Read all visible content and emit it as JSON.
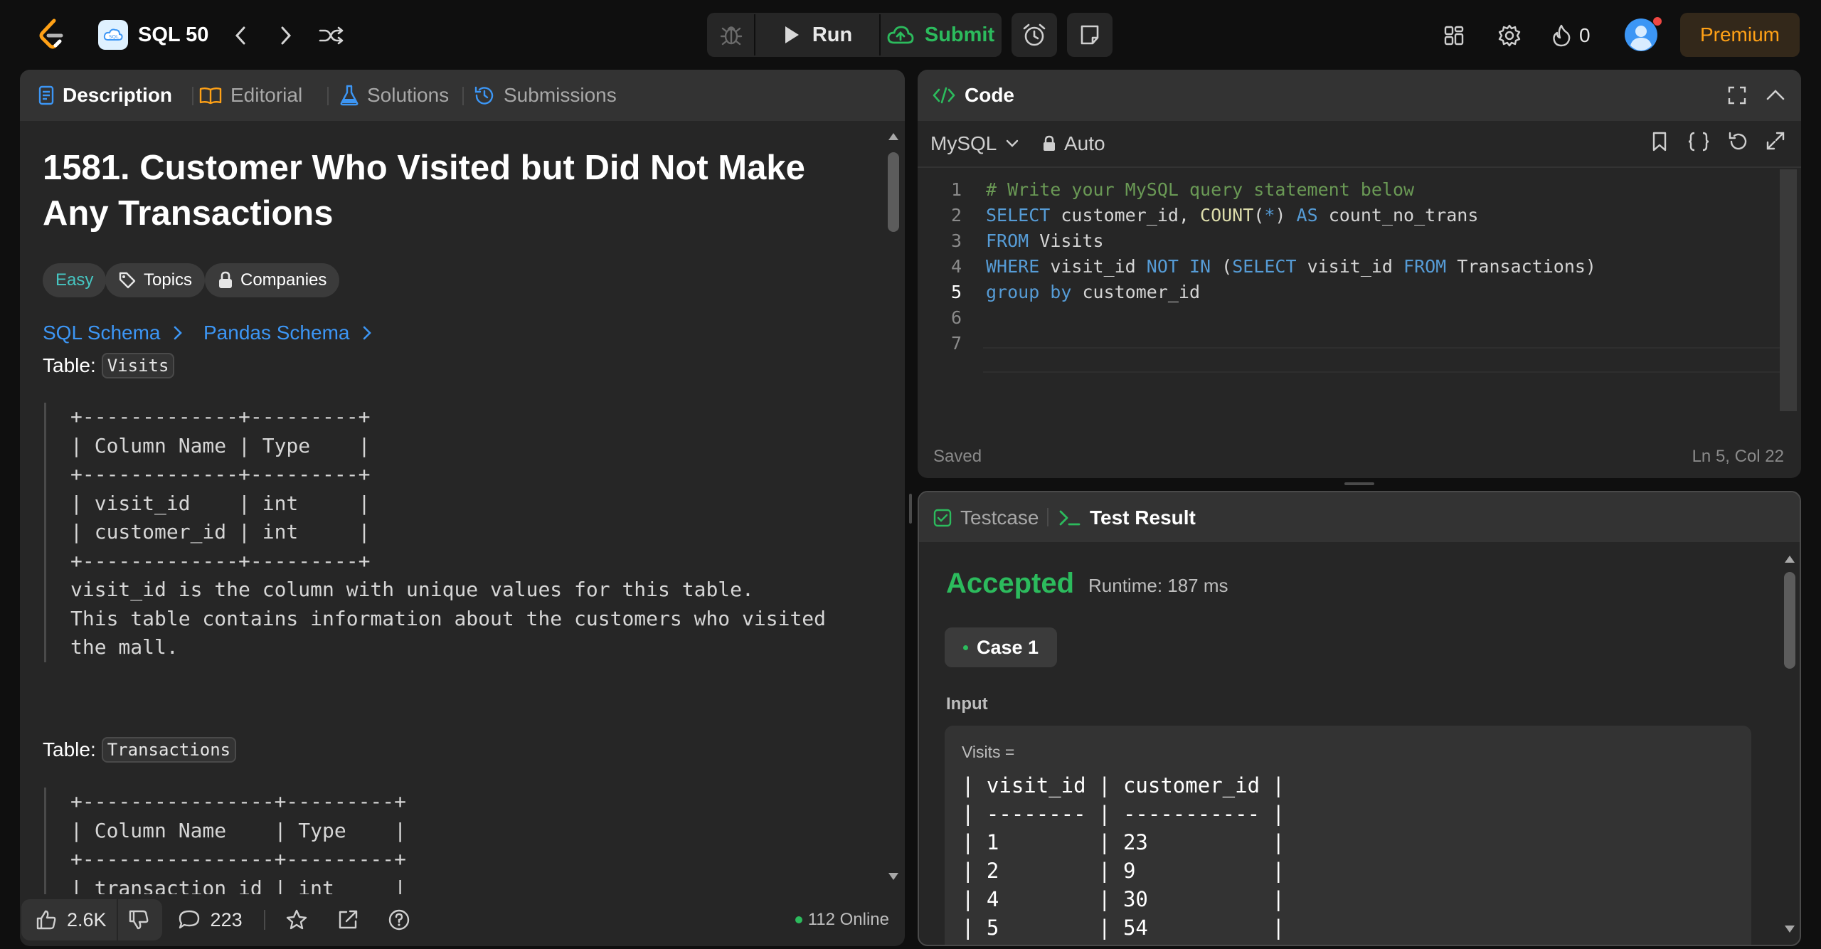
{
  "header": {
    "title": "SQL 50",
    "run_label": "Run",
    "submit_label": "Submit",
    "streak_count": "0",
    "premium_label": "Premium"
  },
  "description": {
    "tabs": [
      {
        "label": "Description"
      },
      {
        "label": "Editorial"
      },
      {
        "label": "Solutions"
      },
      {
        "label": "Submissions"
      }
    ],
    "title": "1581. Customer Who Visited but Did Not Make Any Transactions",
    "difficulty": "Easy",
    "topics_label": "Topics",
    "companies_label": "Companies",
    "sql_schema": "SQL Schema",
    "pandas_schema": "Pandas Schema",
    "table1_prefix": "Table:",
    "table1_name": "Visits",
    "table1_text": "+-------------+---------+\n| Column Name | Type    |\n+-------------+---------+\n| visit_id    | int     |\n| customer_id | int     |\n+-------------+---------+\nvisit_id is the column with unique values for this table.\nThis table contains information about the customers who visited\nthe mall.",
    "table2_prefix": "Table:",
    "table2_name": "Transactions",
    "table2_text": "+----------------+---------+\n| Column Name    | Type    |\n+----------------+---------+\n| transaction_id | int     |",
    "likes": "2.6K",
    "comments": "223",
    "online": "112 Online"
  },
  "code": {
    "title": "Code",
    "language": "MySQL",
    "mode": "Auto",
    "lines": [
      "1",
      "2",
      "3",
      "4",
      "5",
      "6",
      "7"
    ],
    "status": "Saved",
    "cursor": "Ln 5, Col 22"
  },
  "result": {
    "tabs": [
      {
        "label": "Testcase"
      },
      {
        "label": "Test Result"
      }
    ],
    "verdict": "Accepted",
    "runtime": "Runtime: 187 ms",
    "case_label": "Case 1",
    "input_label": "Input",
    "input_var": "Visits =",
    "input_table": "| visit_id | customer_id |\n| -------- | ----------- |\n| 1        | 23          |\n| 2        | 9           |\n| 4        | 30          |\n| 5        | 54          |"
  },
  "colors": {
    "accent_green": "#2cbb5d",
    "link_blue": "#3c96f5",
    "easy_teal": "#46c6c2",
    "premium_orange": "#ffa116"
  }
}
